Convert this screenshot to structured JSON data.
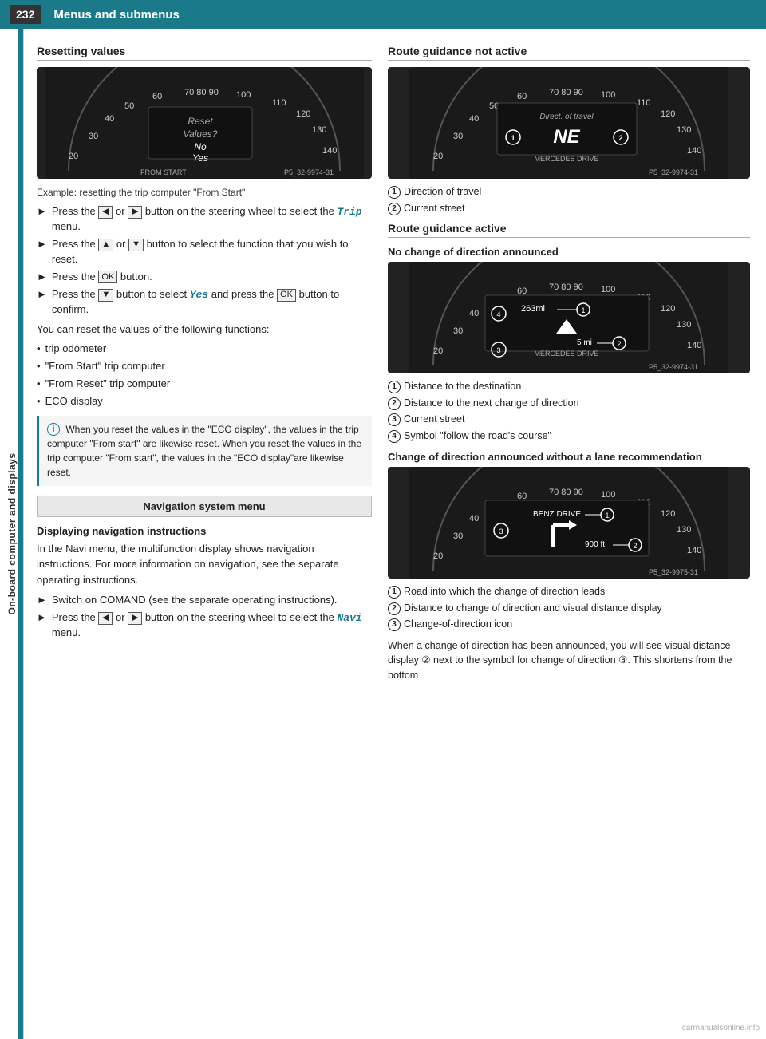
{
  "header": {
    "page_number": "232",
    "chapter_title": "Menus and submenus"
  },
  "sidebar": {
    "label": "On-board computer and displays"
  },
  "left_column": {
    "resetting_values": {
      "title": "Resetting values",
      "example_text": "Example: resetting the trip computer \"From Start\"",
      "steps": [
        "Press the [◄] or [►] button on the steering wheel to select the Trip menu.",
        "Press the [▲] or [▼] button to select the function that you wish to reset.",
        "Press the [OK] button.",
        "Press the [▼] button to select Yes and press the [OK] button to confirm."
      ],
      "following_text": "You can reset the values of the following functions:",
      "functions": [
        "trip odometer",
        "\"From Start\" trip computer",
        "\"From Reset\" trip computer",
        "ECO display"
      ],
      "info_text": "When you reset the values in the \"ECO display\", the values in the trip computer \"From start\" are likewise reset. When you reset the values in the trip computer \"From start\", the values in the \"ECO display\"are likewise reset."
    },
    "nav_system_menu": {
      "label": "Navigation system menu"
    },
    "displaying_nav": {
      "title": "Displaying navigation instructions",
      "intro": "In the Navi menu, the multifunction display shows navigation instructions. For more information on navigation, see the separate operating instructions.",
      "steps": [
        "Switch on COMAND (see the separate operating instructions).",
        "Press the [◄] or [►] button on the steering wheel to select the Navi menu."
      ]
    }
  },
  "right_column": {
    "route_not_active": {
      "title": "Route guidance not active",
      "labels": [
        {
          "num": "1",
          "text": "Direction of travel"
        },
        {
          "num": "2",
          "text": "Current street"
        }
      ]
    },
    "route_active": {
      "title": "Route guidance active"
    },
    "no_change_direction": {
      "title": "No change of direction announced",
      "labels": [
        {
          "num": "1",
          "text": "Distance to the destination"
        },
        {
          "num": "2",
          "text": "Distance to the next change of direction"
        },
        {
          "num": "3",
          "text": "Current street"
        },
        {
          "num": "4",
          "text": "Symbol \"follow the road's course\""
        }
      ]
    },
    "change_direction_no_lane": {
      "title": "Change of direction announced without a lane recommendation",
      "labels": [
        {
          "num": "1",
          "text": "Road into which the change of direction leads"
        },
        {
          "num": "2",
          "text": "Distance to change of direction and visual distance display"
        },
        {
          "num": "3",
          "text": "Change-of-direction icon"
        }
      ],
      "footer_text": "When a change of direction has been announced, you will see visual distance display ② next to the symbol for change of direction ③. This shortens from the bottom"
    }
  },
  "icons": {
    "arrow_right": "►",
    "arrow_left": "◄",
    "arrow_up": "▲",
    "arrow_down": "▼",
    "ok_label": "OK",
    "info": "i"
  }
}
